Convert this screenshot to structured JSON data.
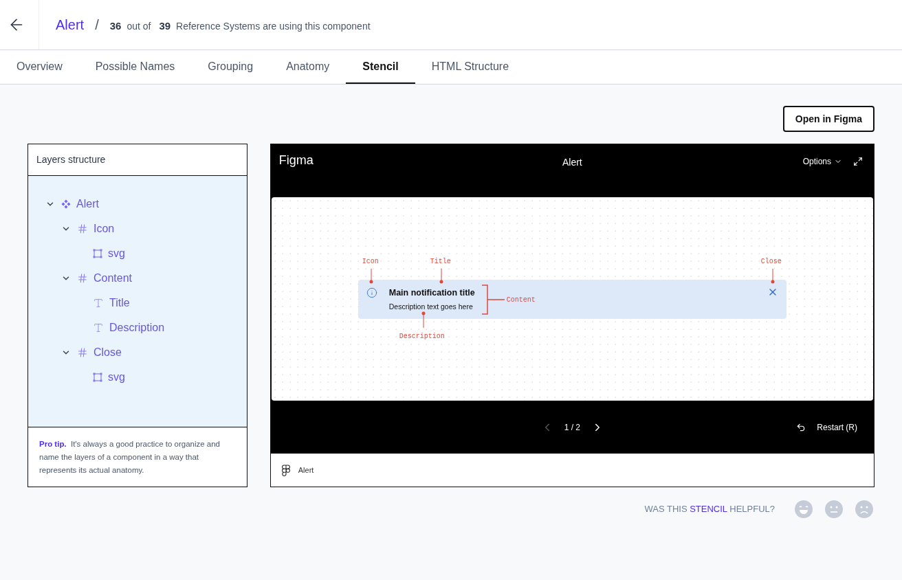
{
  "header": {
    "title": "Alert",
    "separator": "/",
    "count": "36",
    "of_label": "out of",
    "total": "39",
    "description": "Reference Systems are using this component"
  },
  "tabs": [
    {
      "label": "Overview",
      "selected": false
    },
    {
      "label": "Possible Names",
      "selected": false
    },
    {
      "label": "Grouping",
      "selected": false
    },
    {
      "label": "Anatomy",
      "selected": false
    },
    {
      "label": "Stencil",
      "selected": true
    },
    {
      "label": "HTML Structure",
      "selected": false
    }
  ],
  "open_button": "Open in Figma",
  "layers": {
    "title": "Layers structure",
    "items": [
      {
        "label": "Alert",
        "kind": "component",
        "expanded": true,
        "children": [
          {
            "label": "Icon",
            "kind": "frame",
            "expanded": true,
            "children": [
              {
                "label": "svg",
                "kind": "vector"
              }
            ]
          },
          {
            "label": "Content",
            "kind": "frame",
            "expanded": true,
            "children": [
              {
                "label": "Title",
                "kind": "text"
              },
              {
                "label": "Description",
                "kind": "text"
              }
            ]
          },
          {
            "label": "Close",
            "kind": "frame",
            "expanded": true,
            "children": [
              {
                "label": "svg",
                "kind": "vector"
              }
            ]
          }
        ]
      }
    ],
    "tip": "**Pro tip.**  It's always a good practice to organize and name the layers of a component in a way that represents its actual anatomy."
  },
  "figma": {
    "brand": "Figma",
    "title": "Alert",
    "options": "Options",
    "alert_title": "Main notification title",
    "alert_description": "Description text goes here",
    "annotations": {
      "icon": "Icon",
      "title": "Title",
      "close": "Close",
      "content": "Content",
      "description": "Description"
    },
    "page": "1 / 2",
    "restart": "Restart (R)",
    "footer": "Alert"
  },
  "feedback": {
    "before": "WAS THIS",
    "highlight": "STENCIL",
    "after": "HELPFUL?"
  }
}
